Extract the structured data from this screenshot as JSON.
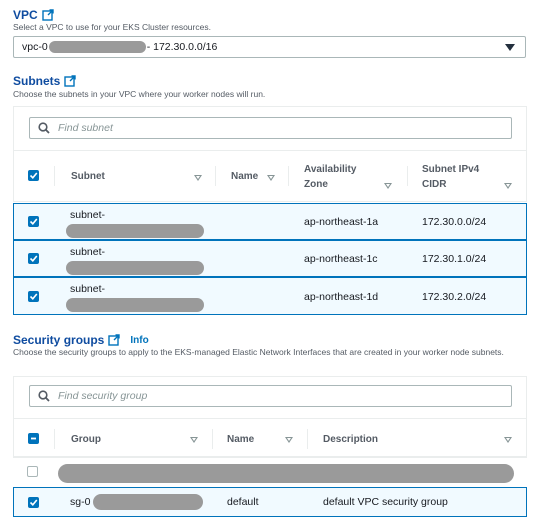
{
  "vpc": {
    "title": "VPC",
    "description": "Select a VPC to use for your EKS Cluster resources.",
    "selected_prefix": "vpc-0",
    "selected_suffix": "- 172.30.0.0/16"
  },
  "subnets": {
    "title": "Subnets",
    "description": "Choose the subnets in your VPC where your worker nodes will run.",
    "search_placeholder": "Find subnet",
    "columns": [
      "Subnet",
      "Name",
      "Availability Zone",
      "Subnet IPv4 CIDR"
    ],
    "rows": [
      {
        "subnet": "subnet-",
        "name": "",
        "az": "ap-northeast-1a",
        "cidr": "172.30.0.0/24",
        "checked": true
      },
      {
        "subnet": "subnet-",
        "name": "",
        "az": "ap-northeast-1c",
        "cidr": "172.30.1.0/24",
        "checked": true
      },
      {
        "subnet": "subnet-",
        "name": "",
        "az": "ap-northeast-1d",
        "cidr": "172.30.2.0/24",
        "checked": true
      }
    ]
  },
  "security_groups": {
    "title": "Security groups",
    "info_label": "Info",
    "description": "Choose the security groups to apply to the EKS-managed Elastic Network Interfaces that are created in your worker node subnets.",
    "search_placeholder": "Find security group",
    "columns": [
      "Group",
      "Name",
      "Description"
    ],
    "rows": [
      {
        "group": "",
        "name": "",
        "description": "",
        "checked": false
      },
      {
        "group": "sg-0",
        "name": "default",
        "description": "default VPC security group",
        "checked": true
      }
    ]
  },
  "colors": {
    "link": "#0073bb",
    "heading": "#0f4ca0",
    "selected_bg": "#f1faff"
  },
  "icons": [
    "external-link-icon",
    "search-icon",
    "dropdown-caret-icon",
    "sort-icon",
    "checkbox-checked-icon",
    "checkbox-indeterminate-icon"
  ]
}
